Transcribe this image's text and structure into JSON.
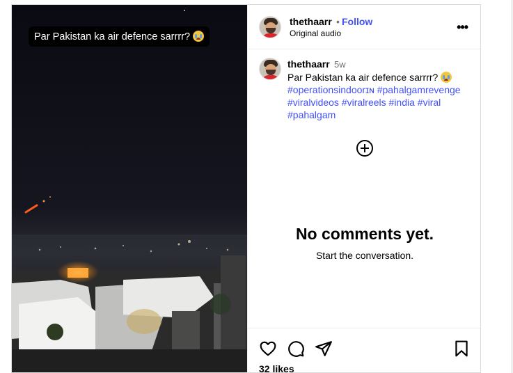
{
  "media": {
    "overlay_text": "Par Pakistan ka air defence sarrrr?"
  },
  "header": {
    "username": "thethaarr",
    "separator": "•",
    "follow_label": "Follow",
    "audio_label": "Original audio",
    "more_label": "•••"
  },
  "caption": {
    "username": "thethaarr",
    "time": "5w",
    "text": "Par Pakistan ka air defence sarrrr?",
    "hashtags": [
      "#operationsindoorɪɴ",
      "#pahalgamrevenge",
      "#viralvideos",
      "#viralreels",
      "#india",
      "#viral",
      "#pahalgam"
    ]
  },
  "comments": {
    "empty_title": "No comments yet.",
    "empty_subtitle": "Start the conversation."
  },
  "footer": {
    "likes": "32 likes"
  },
  "colors": {
    "link": "#4150f7",
    "muted": "#737373",
    "border": "#dbdbdb"
  }
}
